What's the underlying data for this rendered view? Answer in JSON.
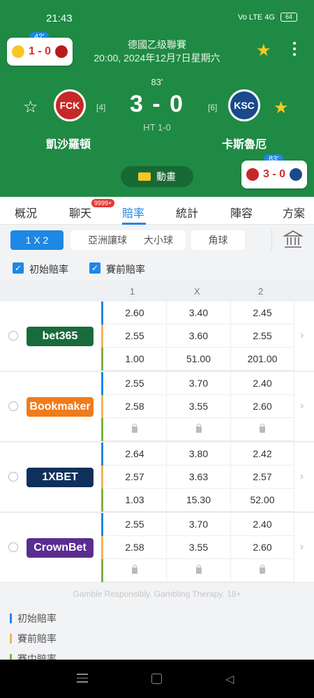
{
  "status_bar": {
    "time": "21:43",
    "icons_text": "Vo LTE 4G",
    "battery": "64"
  },
  "header": {
    "league_name": "德國乙级聯賽",
    "match_datetime": "20:00, 2024年12月7日星期六",
    "minute": "83'",
    "score": "3 - 0",
    "half_time": "HT 1-0",
    "home": {
      "name": "凱沙羅頓",
      "rank": "[4]",
      "logo_text": "FCK"
    },
    "away": {
      "name": "卡斯魯厄",
      "rank": "[6]",
      "logo_text": "KSC"
    },
    "animation_label": "動畫"
  },
  "mini_left": {
    "minute": "42'",
    "score": "1 - 0"
  },
  "mini_right": {
    "minute": "83'",
    "score": "3 - 0"
  },
  "tabs": [
    "概況",
    "聊天",
    "賠率",
    "統計",
    "陣容",
    "方案"
  ],
  "chat_badge": "9999+",
  "active_tab": "賠率",
  "markets": [
    "1 X 2",
    "亞洲讓球",
    "大小球",
    "角球"
  ],
  "filters": {
    "initial": "初始賠率",
    "pre_match": "賽前賠率"
  },
  "columns": [
    "1",
    "X",
    "2"
  ],
  "bookmakers": [
    {
      "name": "bet365",
      "color": "#1a6b3c",
      "rows": [
        [
          "2.60",
          "3.40",
          "2.45"
        ],
        [
          "2.55",
          "3.60",
          "2.55"
        ],
        [
          "1.00",
          "51.00",
          "201.00"
        ]
      ]
    },
    {
      "name": "Bookmaker",
      "color": "#f07b1b",
      "rows": [
        [
          "2.55",
          "3.70",
          "2.40"
        ],
        [
          "2.58",
          "3.55",
          "2.60"
        ],
        [
          "lock",
          "lock",
          "lock"
        ]
      ]
    },
    {
      "name": "1XBET",
      "color": "#10305c",
      "rows": [
        [
          "2.64",
          "3.80",
          "2.42"
        ],
        [
          "2.57",
          "3.63",
          "2.57"
        ],
        [
          "1.03",
          "15.30",
          "52.00"
        ]
      ]
    },
    {
      "name": "CrownBet",
      "color": "#5a2d91",
      "rows": [
        [
          "2.55",
          "3.70",
          "2.40"
        ],
        [
          "2.58",
          "3.55",
          "2.60"
        ],
        [
          "lock",
          "lock",
          "lock"
        ]
      ]
    }
  ],
  "footer_note": "Gamble Responsibly. Gambling Therapy. 18+",
  "legend": [
    {
      "label": "初始賠率",
      "color": "#1e88e5"
    },
    {
      "label": "賽前賠率",
      "color": "#f2b35b"
    },
    {
      "label": "賽中賠率",
      "color": "#7cb342"
    }
  ],
  "row_bar_colors": [
    "#1e88e5",
    "#f2b35b",
    "#7cb342"
  ]
}
